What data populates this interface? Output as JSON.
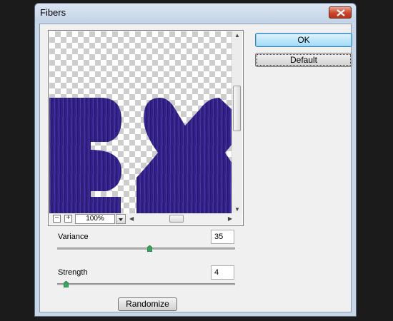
{
  "window": {
    "title": "Fibers"
  },
  "buttons": {
    "ok": "OK",
    "default": "Default",
    "randomize": "Randomize"
  },
  "preview": {
    "zoom": "100%"
  },
  "controls": {
    "variance": {
      "label": "Variance",
      "value": "35",
      "level": 0.52
    },
    "strength": {
      "label": "Strength",
      "value": "4",
      "level": 0.05
    }
  },
  "colors": {
    "fiber_fill": "#332188",
    "slider_thumb": "#3aa55c"
  },
  "icons": [
    "close-icon",
    "zoom-out-icon",
    "zoom-in-icon",
    "dropdown-arrow-icon",
    "scroll-up-icon",
    "scroll-down-icon",
    "scroll-left-icon",
    "scroll-right-icon"
  ]
}
